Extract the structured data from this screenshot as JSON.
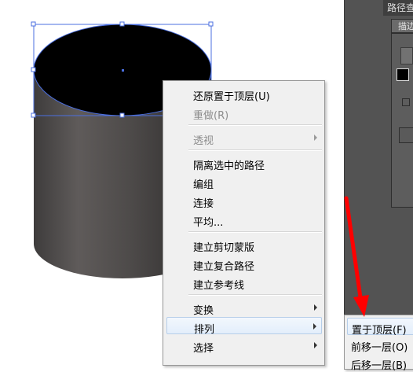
{
  "context_menu": {
    "items": [
      {
        "label": "还原置于顶层(U)",
        "enabled": true,
        "submenu": false
      },
      {
        "label": "重做(R)",
        "enabled": false,
        "submenu": false
      },
      {
        "label": "透视",
        "enabled": false,
        "submenu": true
      },
      {
        "label": "隔离选中的路径",
        "enabled": true,
        "submenu": false
      },
      {
        "label": "编组",
        "enabled": true,
        "submenu": false
      },
      {
        "label": "连接",
        "enabled": true,
        "submenu": false
      },
      {
        "label": "平均...",
        "enabled": true,
        "submenu": false
      },
      {
        "label": "建立剪切蒙版",
        "enabled": true,
        "submenu": false
      },
      {
        "label": "建立复合路径",
        "enabled": true,
        "submenu": false
      },
      {
        "label": "建立参考线",
        "enabled": true,
        "submenu": false
      },
      {
        "label": "变换",
        "enabled": true,
        "submenu": true
      },
      {
        "label": "排列",
        "enabled": true,
        "submenu": true,
        "highlighted": true
      },
      {
        "label": "选择",
        "enabled": true,
        "submenu": true
      }
    ]
  },
  "arrange_submenu": {
    "items": [
      {
        "label": "置于顶层(F)",
        "highlighted": true
      },
      {
        "label": "前移一层(O)"
      },
      {
        "label": "后移一层(B)"
      }
    ]
  },
  "panel": {
    "title": "路径查",
    "tab_label": "描边"
  },
  "colors": {
    "selection": "#4b6fe0",
    "annotation_arrow": "#ff0000",
    "panel_bg": "#535353",
    "menu_bg": "#f0f0f0",
    "highlight_border": "#b6cee9"
  }
}
